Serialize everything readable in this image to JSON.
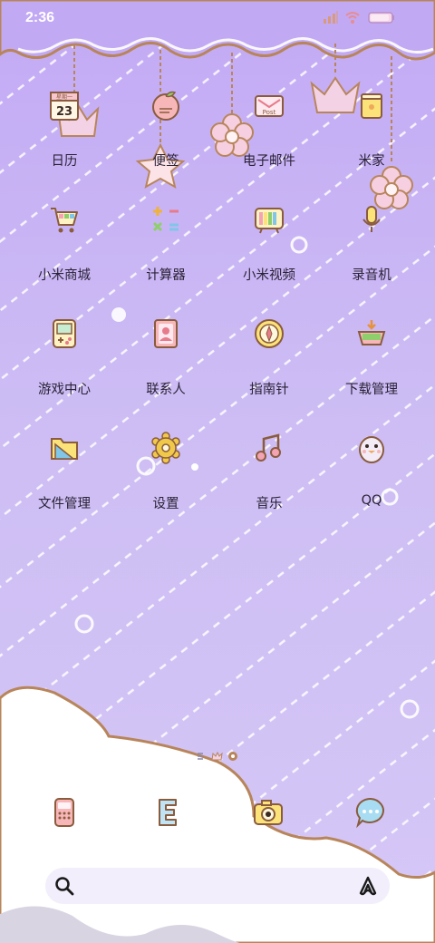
{
  "status": {
    "time": "2:36"
  },
  "apps": [
    {
      "label": "日历",
      "icon": "calendar-icon",
      "calendar_day": "23",
      "calendar_weekday": "星期一"
    },
    {
      "label": "便签",
      "icon": "peach-notes-icon"
    },
    {
      "label": "电子邮件",
      "icon": "post-mail-icon",
      "post_text": "Post"
    },
    {
      "label": "米家",
      "icon": "mijia-cup-icon"
    },
    {
      "label": "小米商城",
      "icon": "shopping-cart-icon"
    },
    {
      "label": "计算器",
      "icon": "calculator-icon"
    },
    {
      "label": "小米视频",
      "icon": "tv-icon"
    },
    {
      "label": "录音机",
      "icon": "microphone-icon"
    },
    {
      "label": "游戏中心",
      "icon": "gameboy-icon"
    },
    {
      "label": "联系人",
      "icon": "contacts-book-icon"
    },
    {
      "label": "指南针",
      "icon": "compass-icon"
    },
    {
      "label": "下载管理",
      "icon": "download-box-icon"
    },
    {
      "label": "文件管理",
      "icon": "folder-icon"
    },
    {
      "label": "设置",
      "icon": "gear-icon"
    },
    {
      "label": "音乐",
      "icon": "music-note-icon"
    },
    {
      "label": "QQ",
      "icon": "penguin-icon"
    }
  ],
  "dock": [
    {
      "icon": "phone-icon"
    },
    {
      "icon": "browser-e-icon"
    },
    {
      "icon": "camera-icon"
    },
    {
      "icon": "messages-bubble-icon"
    }
  ],
  "page_indicator": {
    "pages": 3,
    "current": 3
  },
  "search": {
    "left_icon": "search-icon",
    "right_icon": "assistant-a-icon"
  },
  "colors": {
    "sky": "#c6b3f3",
    "cloud": "#ffffff",
    "outline": "#b8855a",
    "label": "#2a2236"
  }
}
